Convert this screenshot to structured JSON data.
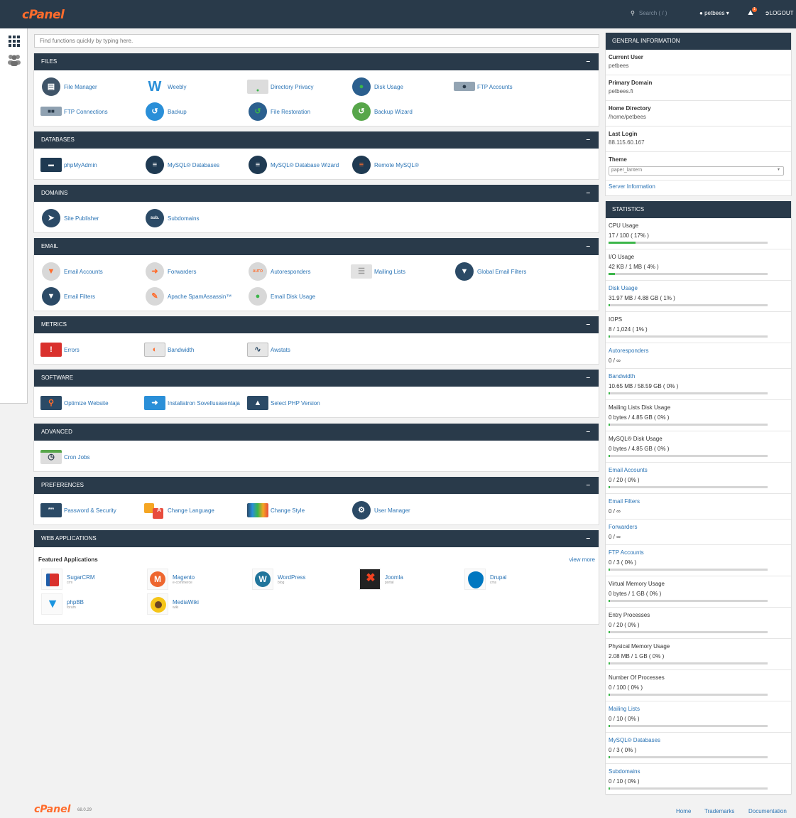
{
  "topbar": {
    "logo": "cPanel",
    "search_placeholder": "Search ( / )",
    "user": "petbees",
    "notification_count": "1",
    "logout": "LOGOUT"
  },
  "search": {
    "placeholder": "Find functions quickly by typing here."
  },
  "sections": {
    "files": {
      "title": "FILES",
      "items": [
        "File Manager",
        "Weebly",
        "Directory Privacy",
        "Disk Usage",
        "FTP Accounts",
        "FTP Connections",
        "Backup",
        "File Restoration",
        "Backup Wizard"
      ]
    },
    "databases": {
      "title": "DATABASES",
      "items": [
        "phpMyAdmin",
        "MySQL® Databases",
        "MySQL® Database Wizard",
        "Remote MySQL®"
      ]
    },
    "domains": {
      "title": "DOMAINS",
      "items": [
        "Site Publisher",
        "Subdomains"
      ]
    },
    "email": {
      "title": "EMAIL",
      "items": [
        "Email Accounts",
        "Forwarders",
        "Autoresponders",
        "Mailing Lists",
        "Global Email Filters",
        "Email Filters",
        "Apache SpamAssassin™",
        "Email Disk Usage"
      ]
    },
    "metrics": {
      "title": "METRICS",
      "items": [
        "Errors",
        "Bandwidth",
        "Awstats"
      ]
    },
    "software": {
      "title": "SOFTWARE",
      "items": [
        "Optimize Website",
        "Installatron Sovellusasentaja",
        "Select PHP Version"
      ]
    },
    "advanced": {
      "title": "ADVANCED",
      "items": [
        "Cron Jobs"
      ]
    },
    "preferences": {
      "title": "PREFERENCES",
      "items": [
        "Password & Security",
        "Change Language",
        "Change Style",
        "User Manager"
      ]
    },
    "webapps": {
      "title": "WEB APPLICATIONS",
      "featured": "Featured Applications",
      "view_more": "view more",
      "apps": [
        {
          "name": "SugarCRM",
          "sub": "crm"
        },
        {
          "name": "Magento",
          "sub": "e-commerce"
        },
        {
          "name": "WordPress",
          "sub": "blog"
        },
        {
          "name": "Joomla",
          "sub": "portal"
        },
        {
          "name": "Drupal",
          "sub": "cms"
        },
        {
          "name": "phpBB",
          "sub": "forum"
        },
        {
          "name": "MediaWiki",
          "sub": "wiki"
        }
      ]
    }
  },
  "general": {
    "title": "GENERAL INFORMATION",
    "rows": [
      {
        "label": "Current User",
        "value": "petbees"
      },
      {
        "label": "Primary Domain",
        "value": "petbees.fi"
      },
      {
        "label": "Home Directory",
        "value": "/home/petbees"
      },
      {
        "label": "Last Login",
        "value": "88.115.60.167"
      }
    ],
    "theme_label": "Theme",
    "theme_value": "paper_lantern",
    "server_info": "Server Information"
  },
  "statistics": {
    "title": "STATISTICS",
    "rows": [
      {
        "name": "CPU Usage",
        "value": "17 / 100 ( 17% )",
        "percent": 17
      },
      {
        "name": "I/O Usage",
        "value": "42 KB / 1 MB ( 4% )",
        "percent": 4
      },
      {
        "name": "Disk Usage",
        "value": "31.97 MB / 4.88 GB ( 1% )",
        "percent": 1
      },
      {
        "name": "IOPS",
        "value": "8 / 1,024 ( 1% )",
        "percent": 1
      },
      {
        "name": "Autoresponders",
        "value": "0 / ∞"
      },
      {
        "name": "Bandwidth",
        "value": "10.65 MB / 58.59 GB ( 0% )",
        "percent": 0
      },
      {
        "name": "Mailing Lists Disk Usage",
        "value": "0 bytes / 4.85 GB ( 0% )",
        "percent": 0
      },
      {
        "name": "MySQL® Disk Usage",
        "value": "0 bytes / 4.85 GB ( 0% )",
        "percent": 0
      },
      {
        "name": "Email Accounts",
        "value": "0 / 20 ( 0% )",
        "percent": 0
      },
      {
        "name": "Email Filters",
        "value": "0 / ∞"
      },
      {
        "name": "Forwarders",
        "value": "0 / ∞"
      },
      {
        "name": "FTP Accounts",
        "value": "0 / 3 ( 0% )",
        "percent": 0
      },
      {
        "name": "Virtual Memory Usage",
        "value": "0 bytes / 1 GB ( 0% )",
        "percent": 0
      },
      {
        "name": "Entry Processes",
        "value": "0 / 20 ( 0% )",
        "percent": 0
      },
      {
        "name": "Physical Memory Usage",
        "value": "2.08 MB / 1 GB ( 0% )",
        "percent": 0
      },
      {
        "name": "Number Of Processes",
        "value": "0 / 100 ( 0% )",
        "percent": 0
      },
      {
        "name": "Mailing Lists",
        "value": "0 / 10 ( 0% )",
        "percent": 0
      },
      {
        "name": "MySQL® Databases",
        "value": "0 / 3 ( 0% )",
        "percent": 0
      },
      {
        "name": "Subdomains",
        "value": "0 / 10 ( 0% )",
        "percent": 0
      }
    ]
  },
  "footer": {
    "logo": "cPanel",
    "version": "68.0.29",
    "links": [
      "Home",
      "Trademarks",
      "Documentation"
    ]
  },
  "colors": {
    "header": "#293a4a",
    "accent": "#ff6c2c",
    "link": "#2b74b5",
    "progress": "#3cb64a"
  }
}
